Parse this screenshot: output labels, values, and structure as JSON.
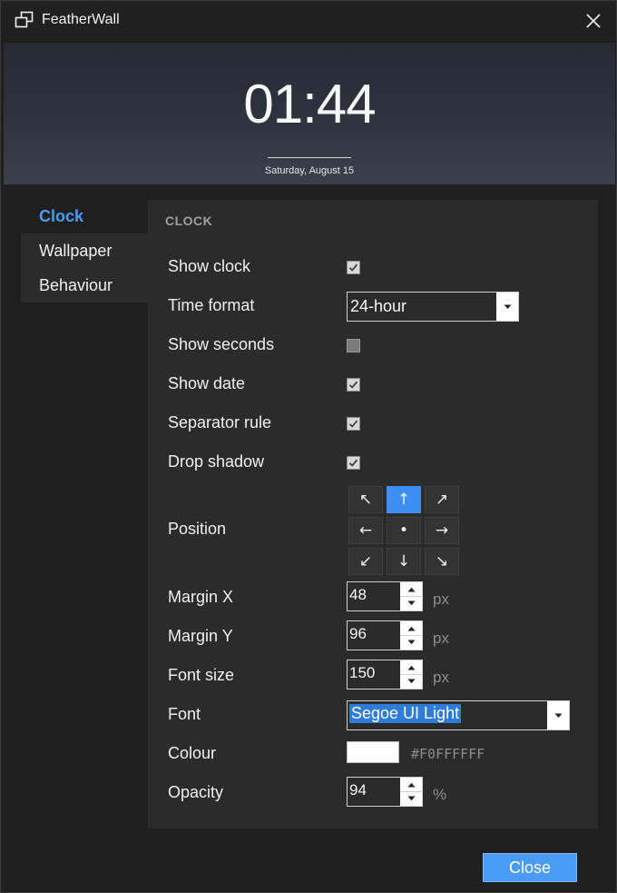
{
  "window": {
    "title": "FeatherWall",
    "icon": "app-window-icon",
    "close_icon": "close-icon"
  },
  "preview": {
    "time": "01:44",
    "date": "Saturday, August 15"
  },
  "nav": {
    "items": [
      "Clock",
      "Wallpaper",
      "Behaviour"
    ],
    "active": "Clock",
    "accent": "#4a9bf5"
  },
  "section": {
    "title": "CLOCK"
  },
  "fields": {
    "show_clock": {
      "label": "Show clock",
      "checked": true
    },
    "time_format": {
      "label": "Time format",
      "value": "24-hour"
    },
    "show_seconds": {
      "label": "Show seconds",
      "checked": false
    },
    "show_date": {
      "label": "Show date",
      "checked": true
    },
    "separator_rule": {
      "label": "Separator rule",
      "checked": true
    },
    "drop_shadow": {
      "label": "Drop shadow",
      "checked": true
    },
    "position": {
      "label": "Position",
      "options": [
        "↖",
        "↑",
        "↗",
        "←",
        "•",
        "→",
        "↙",
        "↓",
        "↘"
      ],
      "selected": "↑"
    },
    "margin_x": {
      "label": "Margin X",
      "value": "48",
      "unit": "px"
    },
    "margin_y": {
      "label": "Margin Y",
      "value": "96",
      "unit": "px"
    },
    "font_size": {
      "label": "Font size",
      "value": "150",
      "unit": "px"
    },
    "font": {
      "label": "Font",
      "value": "Segoe UI Light"
    },
    "colour": {
      "label": "Colour",
      "hex": "#F0FFFFFF",
      "swatch": "#ffffff"
    },
    "opacity": {
      "label": "Opacity",
      "value": "94",
      "unit": "%"
    }
  },
  "footer": {
    "close_label": "Close"
  }
}
